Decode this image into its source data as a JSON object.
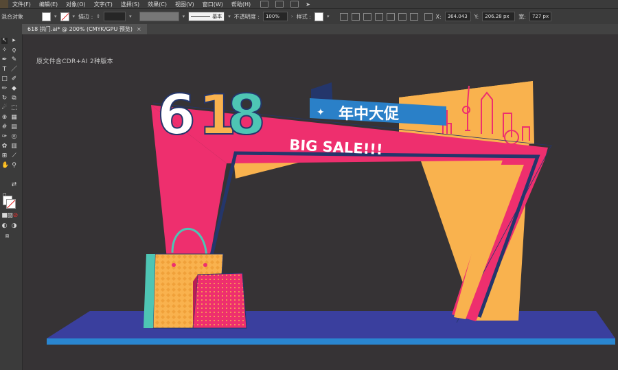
{
  "menu": {
    "items": [
      "文件(F)",
      "编辑(E)",
      "对象(O)",
      "文字(T)",
      "选择(S)",
      "效果(C)",
      "视图(V)",
      "窗口(W)",
      "帮助(H)"
    ]
  },
  "control": {
    "selection_label": "混合对象",
    "stroke_label": "描边 :",
    "stroke_style": "基本",
    "opacity_label": "不透明度 :",
    "opacity_value": "100%",
    "style_label": "样式 :",
    "x_label": "X:",
    "x_value": "364.043",
    "y_label": "Y:",
    "y_value": "206.28 px",
    "w_label": "宽:",
    "w_value": "727 px"
  },
  "document": {
    "tab_title": "618 拱门.ai* @ 200% (CMYK/GPU 预览)",
    "close_glyph": "×"
  },
  "artwork": {
    "note": "原文件含CDR+AI 2种版本",
    "number": "618",
    "badge_text": "年中大促",
    "sale_text": "BIG SALE!!!",
    "colors": {
      "pink": "#ee2f6e",
      "yellow": "#f9b24e",
      "teal": "#4ec5b4",
      "navy": "#24366b",
      "blue": "#2a80c8",
      "floor": "#3a3f9e",
      "floor_edge": "#2a86d0",
      "canvas_bg": "#363335"
    }
  }
}
